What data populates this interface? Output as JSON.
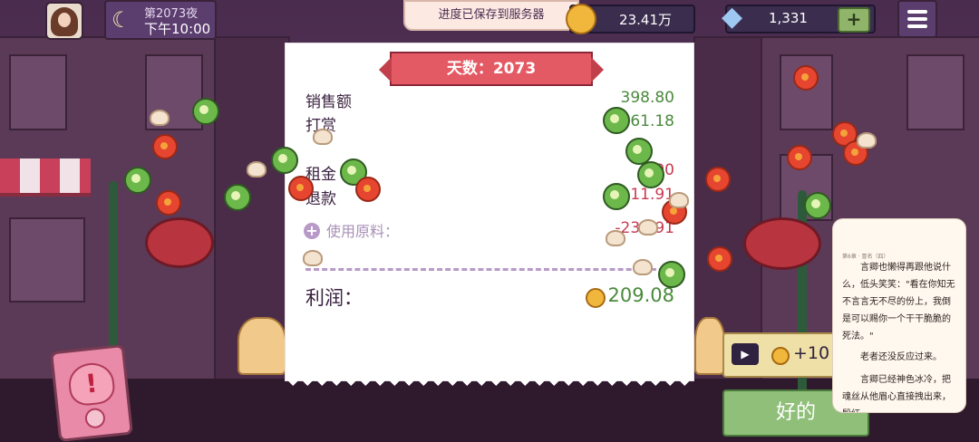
{
  "hud": {
    "night_title": "第2073夜",
    "night_time": "下午10:00",
    "toast": "进度已保存到服务器",
    "coins": "23.41万",
    "gems": "1,331",
    "plus_label": "+"
  },
  "receipt": {
    "day_label": "天数：2073",
    "rows": [
      {
        "label": "销售额",
        "value": "398.80"
      },
      {
        "label": "打赏",
        "value": "61.18"
      },
      {
        "label": "租金",
        "value": "-100"
      },
      {
        "label": "退款",
        "value": "-11.91"
      }
    ],
    "materials_label": "使用原料：",
    "materials_value": "-239.91",
    "profit_label": "利润：",
    "profit_value": "209.08"
  },
  "actions": {
    "ad_reward": "+10",
    "ok_label": "好的"
  },
  "story": {
    "header": "第6章 · 冒名（四）",
    "p1": "言卿也懒得再跟他说什么，低头笑笑：\"看在你知无不言言无不尽的份上，我倒是可以赐你一个干干脆脆的死法。\"",
    "p2": "老者还没反应过来。",
    "p3": "言卿已经神色冰冷，把魂丝从他眉心直接拽出来，殷红"
  },
  "colors": {
    "positive": "#4a8a3c",
    "negative": "#c73a52",
    "ribbon": "#e45a64",
    "ok_button": "#8fbf78"
  }
}
